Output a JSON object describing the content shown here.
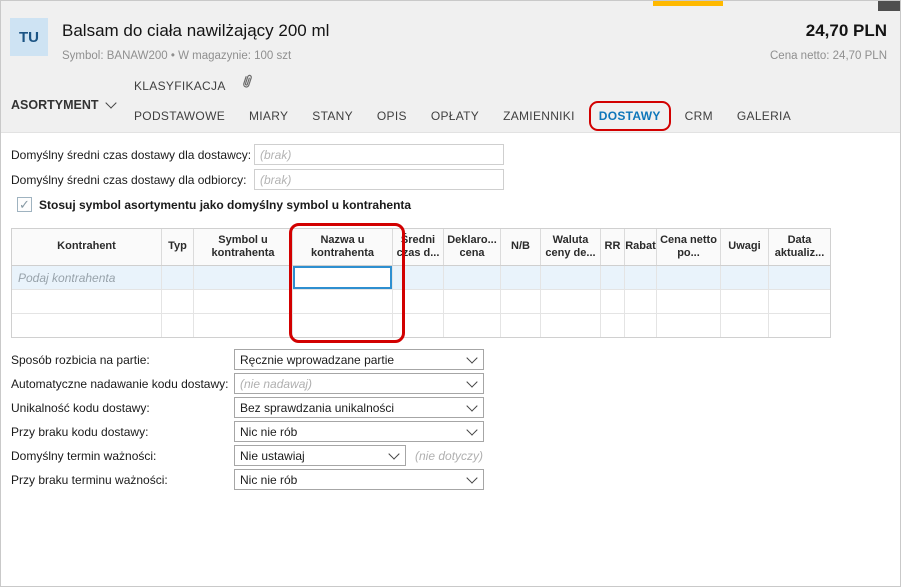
{
  "header": {
    "badge": "TU",
    "title": "Balsam do ciała nawilżający 200 ml",
    "subtitle": "Symbol: BANAW200  •  W magazynie: 100 szt",
    "price_gross": "24,70 PLN",
    "price_net": "Cena netto: 24,70 PLN"
  },
  "nav": {
    "asortyment_label": "ASORTYMENT",
    "klasyfikacja_label": "KLASYFIKACJA",
    "tabs": [
      {
        "label": "PODSTAWOWE"
      },
      {
        "label": "MIARY"
      },
      {
        "label": "STANY"
      },
      {
        "label": "OPIS"
      },
      {
        "label": "OPŁATY"
      },
      {
        "label": "ZAMIENNIKI"
      },
      {
        "label": "DOSTAWY",
        "active": true,
        "annotated": true
      },
      {
        "label": "CRM"
      },
      {
        "label": "GALERIA"
      }
    ]
  },
  "delivery_form": {
    "row1_label": "Domyślny średni czas dostawy dla dostawcy:",
    "row1_placeholder": "(brak)",
    "row2_label": "Domyślny średni czas dostawy dla odbiorcy:",
    "row2_placeholder": "(brak)",
    "checkbox_label": "Stosuj symbol asortymentu jako domyślny symbol u kontrahenta",
    "checkbox_checked": true
  },
  "contractors_table": {
    "columns": [
      "Kontrahent",
      "Typ",
      "Symbol u kontrahenta",
      "Nazwa u kontrahenta",
      "Średni czas d...",
      "Deklaro... cena",
      "N/B",
      "Waluta ceny de...",
      "RR",
      "Rabat",
      "Cena netto po...",
      "Uwagi",
      "Data aktualiz..."
    ],
    "new_row_placeholder": "Podaj kontrahenta"
  },
  "batch_form": {
    "rows": [
      {
        "label": "Sposób rozbicia na partie:",
        "value": "Ręcznie wprowadzane partie"
      },
      {
        "label": "Automatyczne nadawanie kodu dostawy:",
        "value": "(nie nadawaj)",
        "muted": true
      },
      {
        "label": "Unikalność kodu dostawy:",
        "value": "Bez sprawdzania unikalności"
      },
      {
        "label": "Przy braku kodu dostawy:",
        "value": "Nic nie rób"
      },
      {
        "label": "Domyślny termin ważności:",
        "value": "Nie ustawiaj",
        "suffix": "(nie dotyczy)"
      },
      {
        "label": "Przy braku terminu ważności:",
        "value": "Nic nie rób"
      }
    ]
  },
  "icons": {
    "check": "✓"
  },
  "colors": {
    "accent_yellow": "#ffb900",
    "active_tab_blue": "#0e76ba",
    "annotation_red": "#d20000",
    "selection_blue": "#2e8fd0",
    "new_row_blue": "#e9f3fb"
  }
}
